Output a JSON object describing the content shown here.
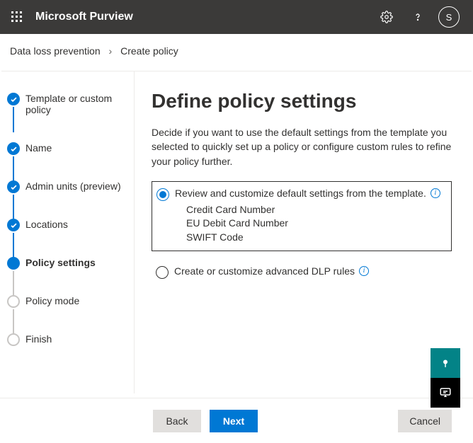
{
  "topbar": {
    "brand": "Microsoft Purview",
    "avatar_initial": "S"
  },
  "breadcrumb": {
    "parent": "Data loss prevention",
    "current": "Create policy"
  },
  "steps": [
    {
      "label": "Template or custom policy",
      "state": "done"
    },
    {
      "label": "Name",
      "state": "done"
    },
    {
      "label": "Admin units (preview)",
      "state": "done"
    },
    {
      "label": "Locations",
      "state": "done"
    },
    {
      "label": "Policy settings",
      "state": "current"
    },
    {
      "label": "Policy mode",
      "state": "pending"
    },
    {
      "label": "Finish",
      "state": "pending"
    }
  ],
  "main": {
    "heading": "Define policy settings",
    "description": "Decide if you want to use the default settings from the template you selected to quickly set up a policy or configure custom rules to refine your policy further.",
    "option1": {
      "label": "Review and customize default settings from the template.",
      "selected": true,
      "items": [
        "Credit Card Number",
        "EU Debit Card Number",
        "SWIFT Code"
      ]
    },
    "option2": {
      "label": "Create or customize advanced DLP rules",
      "selected": false
    }
  },
  "buttons": {
    "back": "Back",
    "next": "Next",
    "cancel": "Cancel"
  }
}
